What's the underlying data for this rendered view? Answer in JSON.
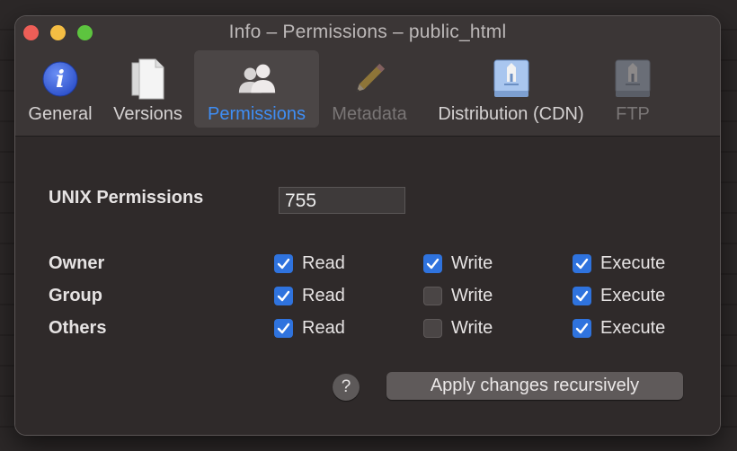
{
  "window": {
    "title": "Info – Permissions – public_html"
  },
  "tabs": [
    {
      "label": "General"
    },
    {
      "label": "Versions"
    },
    {
      "label": "Permissions"
    },
    {
      "label": "Metadata"
    },
    {
      "label": "Distribution (CDN)"
    },
    {
      "label": "FTP"
    }
  ],
  "permissions": {
    "unix_label": "UNIX Permissions",
    "unix_value": "755",
    "rows": [
      {
        "label": "Owner",
        "read": true,
        "write": true,
        "execute": true
      },
      {
        "label": "Group",
        "read": true,
        "write": false,
        "execute": true
      },
      {
        "label": "Others",
        "read": true,
        "write": false,
        "execute": true
      }
    ],
    "read_label": "Read",
    "write_label": "Write",
    "execute_label": "Execute"
  },
  "footer": {
    "help": "?",
    "apply_label": "Apply changes recursively"
  },
  "colors": {
    "accent": "#3f8ef5",
    "checkbox_on": "#2f73de"
  }
}
